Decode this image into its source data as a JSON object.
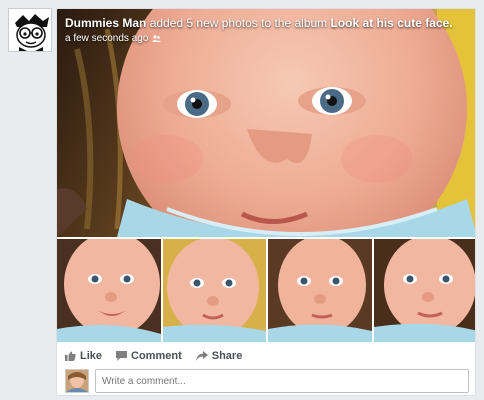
{
  "story": {
    "author": "Dummies Man",
    "action_text": "added 5 new photos to the album",
    "album_title": "Look at his cute face.",
    "timestamp": "a few seconds ago",
    "audience_icon": "friends-icon"
  },
  "photos": {
    "hero_alt": "baby face close-up",
    "thumb_count": 4
  },
  "actions": {
    "like_label": "Like",
    "comment_label": "Comment",
    "share_label": "Share"
  },
  "comment_box": {
    "placeholder": "Write a comment..."
  },
  "colors": {
    "page_bg": "#e9ebee",
    "text_action": "#4b4f56",
    "placeholder": "#90949c",
    "skin": "#f2b7a1",
    "shirt": "#a8d8e8"
  }
}
